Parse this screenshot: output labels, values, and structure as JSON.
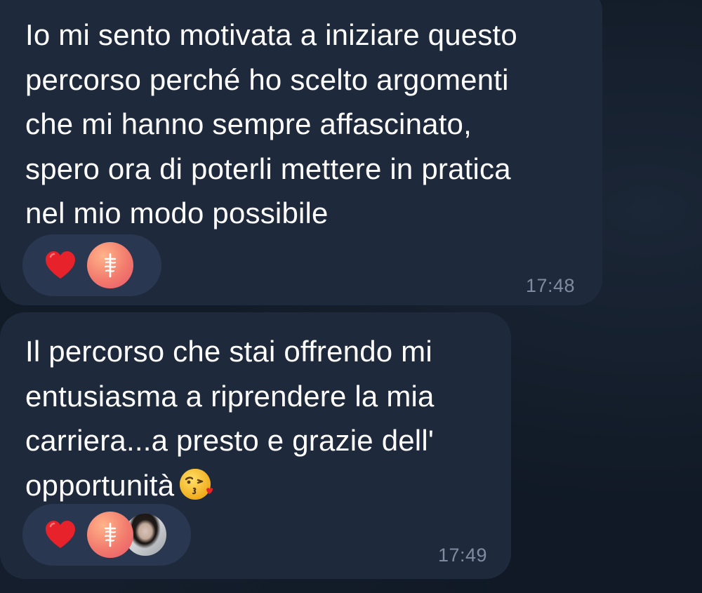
{
  "messages": [
    {
      "text": "Io mi sento motivata a iniziare questo\npercorso perché ho scelto argomenti\nche mi hanno sempre affascinato,\nspero ora di poterli mettere in pratica\nnel mio modo possibile",
      "reaction_icon": "heart-icon",
      "reactors": [
        "avatar-caduceus"
      ],
      "time": "17:48"
    },
    {
      "text": "Il percorso che stai offrendo mi\nentusiasma a riprendere la mia\ncarriera...a presto e grazie dell'\nopportunità",
      "emoji": "kissing-face-with-heart-emoji",
      "reaction_icon": "heart-icon",
      "reactors": [
        "avatar-caduceus",
        "avatar-photo"
      ],
      "time": "17:49"
    }
  ],
  "colors": {
    "background": "#101925",
    "bubble": "#1e2a3c",
    "reaction_pill": "#2a3750",
    "heart": "#e8222b",
    "timestamp": "#7f8ba0",
    "text": "#ffffff"
  }
}
